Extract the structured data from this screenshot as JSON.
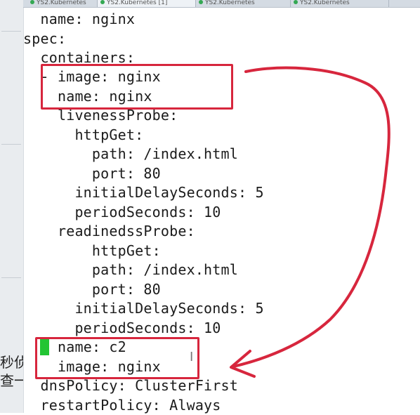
{
  "tabs": [
    "YS2.Kubernetes",
    "YS2.Kubernetes [1]",
    "YS2.Kubernetes",
    "YS2.Kubernetes"
  ],
  "left_fragments": [
    "秒侦",
    "查一"
  ],
  "yaml_lines": [
    "  name: nginx",
    "spec:",
    "  containers:",
    "  - image: nginx",
    "    name: nginx",
    "    livenessProbe:",
    "      httpGet:",
    "        path: /index.html",
    "        port: 80",
    "      initialDelaySeconds: 5",
    "      periodSeconds: 10",
    "    readinedssProbe:",
    "        httpGet:",
    "        path: /index.html",
    "        port: 80",
    "      initialDelaySeconds: 5",
    "      periodSeconds: 10",
    "  - name: c2",
    "    image: nginx",
    "  dnsPolicy: ClusterFirst",
    "  restartPolicy: Always"
  ],
  "cursor_line_rest": " name: c2",
  "colors": {
    "highlight_box": "#d7263d",
    "cursor": "#22c533",
    "arrow": "#d7263d"
  },
  "icons": {
    "text_cursor": "text-cursor-icon"
  },
  "text_cursor_glyph": "I"
}
